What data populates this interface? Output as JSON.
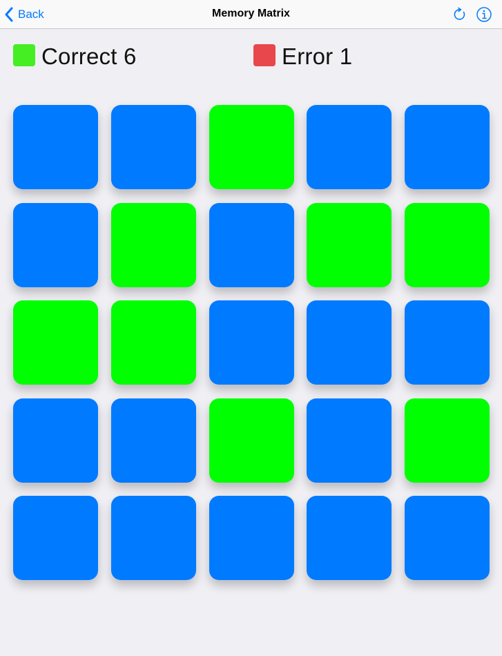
{
  "navbar": {
    "back_label": "Back",
    "title": "Memory Matrix",
    "icons": [
      "chevron-left-icon",
      "refresh-icon",
      "info-icon"
    ]
  },
  "score": {
    "correct_label": "Correct 6",
    "error_label": "Error 1"
  },
  "colors": {
    "accent": "#007aff",
    "tile_blue": "#007aff",
    "tile_green": "#00ff00",
    "correct_swatch": "#44ee22",
    "error_swatch": "#e8474b",
    "background": "#efeff4"
  },
  "grid": {
    "rows": 5,
    "cols": 5,
    "cells": [
      [
        "blue",
        "blue",
        "green",
        "blue",
        "blue"
      ],
      [
        "blue",
        "green",
        "blue",
        "green",
        "green"
      ],
      [
        "green",
        "green",
        "blue",
        "blue",
        "blue"
      ],
      [
        "blue",
        "blue",
        "green",
        "blue",
        "green"
      ],
      [
        "blue",
        "blue",
        "blue",
        "blue",
        "blue"
      ]
    ]
  }
}
